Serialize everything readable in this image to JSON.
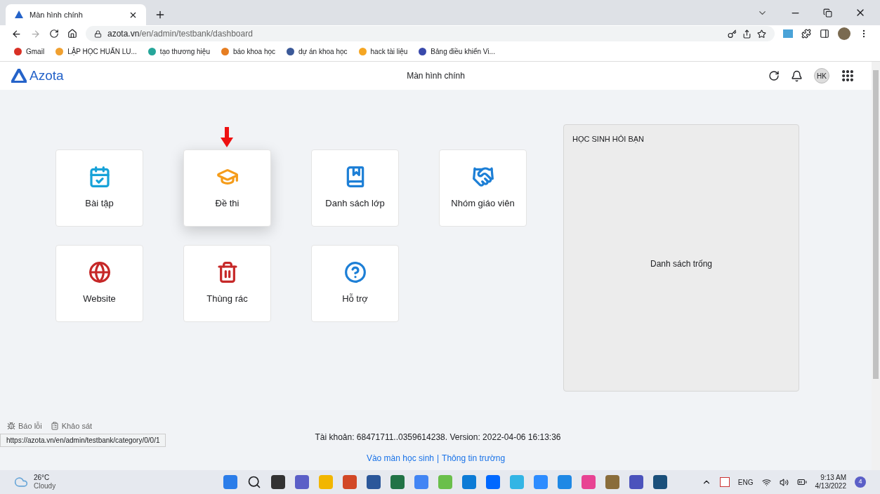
{
  "browser": {
    "tabs": [
      {
        "title": "Màn hình chính",
        "selected": true
      }
    ],
    "url_host": "azota.vn",
    "url_path": "/en/admin/testbank/dashboard",
    "bookmarks": [
      "Gmail",
      "LẬP HỌC HUẤN LU...",
      "tạo thương hiệu",
      "báo khoa học",
      "dự án khoa học",
      "hack tài liệu",
      "Bảng điều khiển Vi..."
    ],
    "status_url": "https://azota.vn/en/admin/testbank/category/0/0/1"
  },
  "header": {
    "logo": "Azota",
    "title": "Màn hình chính",
    "avatar": "HK"
  },
  "tiles": [
    {
      "label": "Bài tập",
      "highlighted": false
    },
    {
      "label": "Đề thi",
      "highlighted": true
    },
    {
      "label": "Danh sách lớp",
      "highlighted": false
    },
    {
      "label": "Nhóm giáo viên",
      "highlighted": false
    },
    {
      "label": "Website",
      "highlighted": false
    },
    {
      "label": "Thùng rác",
      "highlighted": false
    },
    {
      "label": "Hỗ trợ",
      "highlighted": false
    }
  ],
  "panel": {
    "title": "HỌC SINH HỎI BẠN",
    "empty": "Danh sách trống"
  },
  "footer": {
    "actions": [
      "Báo lỗi",
      "Khảo sát"
    ],
    "account": "Tài khoản: 68471711..0359614238. Version: 2022-04-06 16:13:36",
    "links": [
      "Vào màn học sinh",
      "Thông tin trường"
    ],
    "separator": "|"
  },
  "taskbar": {
    "temperature": "26°C",
    "weather": "Cloudy",
    "language": "ENG",
    "time": "9:13 AM",
    "date": "4/13/2022",
    "notifications": "4"
  }
}
